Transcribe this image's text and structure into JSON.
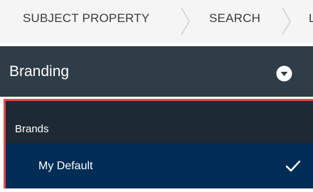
{
  "breadcrumb": {
    "items": [
      {
        "label": "SUBJECT PROPERTY"
      },
      {
        "label": "SEARCH"
      },
      {
        "label": "L"
      }
    ]
  },
  "branding": {
    "title": "Branding",
    "toggle_icon": "chevron-down-circle-icon"
  },
  "brands": {
    "heading": "Brands",
    "items": [
      {
        "label": "My Default",
        "selected": true,
        "icon": "checkmark-icon"
      }
    ]
  },
  "colors": {
    "branding_header_bg": "#2e3d47",
    "panel_bg": "#1e2a33",
    "selected_item_bg": "#002d55",
    "highlight_border": "#e04b4b"
  }
}
